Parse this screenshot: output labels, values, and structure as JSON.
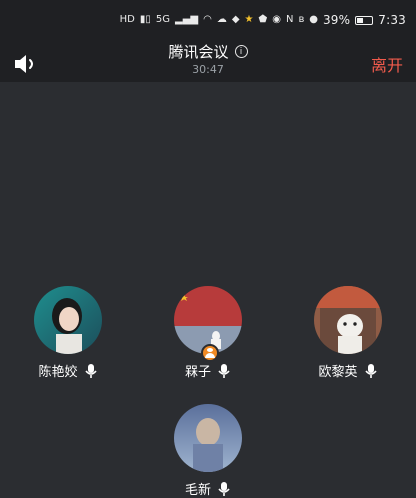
{
  "status_bar": {
    "network_left": "HD",
    "signal1": "5G",
    "battery_percent": "39%",
    "time": "7:33"
  },
  "header": {
    "title": "腾讯会议",
    "timer": "30:47",
    "leave_label": "离开"
  },
  "participants": [
    {
      "name": "陈艳姣",
      "is_host": false,
      "avatar_colors": [
        "#1f8e8e",
        "#d8d2ca"
      ]
    },
    {
      "name": "槑子",
      "is_host": true,
      "avatar_colors": [
        "#b73b3b",
        "#8c9bb1"
      ]
    },
    {
      "name": "欧黎英",
      "is_host": false,
      "avatar_colors": [
        "#8f5c46",
        "#e6e2dc"
      ]
    },
    {
      "name": "毛新",
      "is_host": false,
      "avatar_colors": [
        "#5a6f9b",
        "#9fb4cf"
      ]
    }
  ],
  "colors": {
    "background": "#2b2d31",
    "topbar": "#1f2023",
    "leave": "#f25b4c",
    "host_badge": "#f08a24"
  },
  "icons": [
    "speaker-icon",
    "info-icon",
    "microphone-icon",
    "host-badge-icon",
    "wifi-icon",
    "bluetooth-icon",
    "battery-icon"
  ]
}
